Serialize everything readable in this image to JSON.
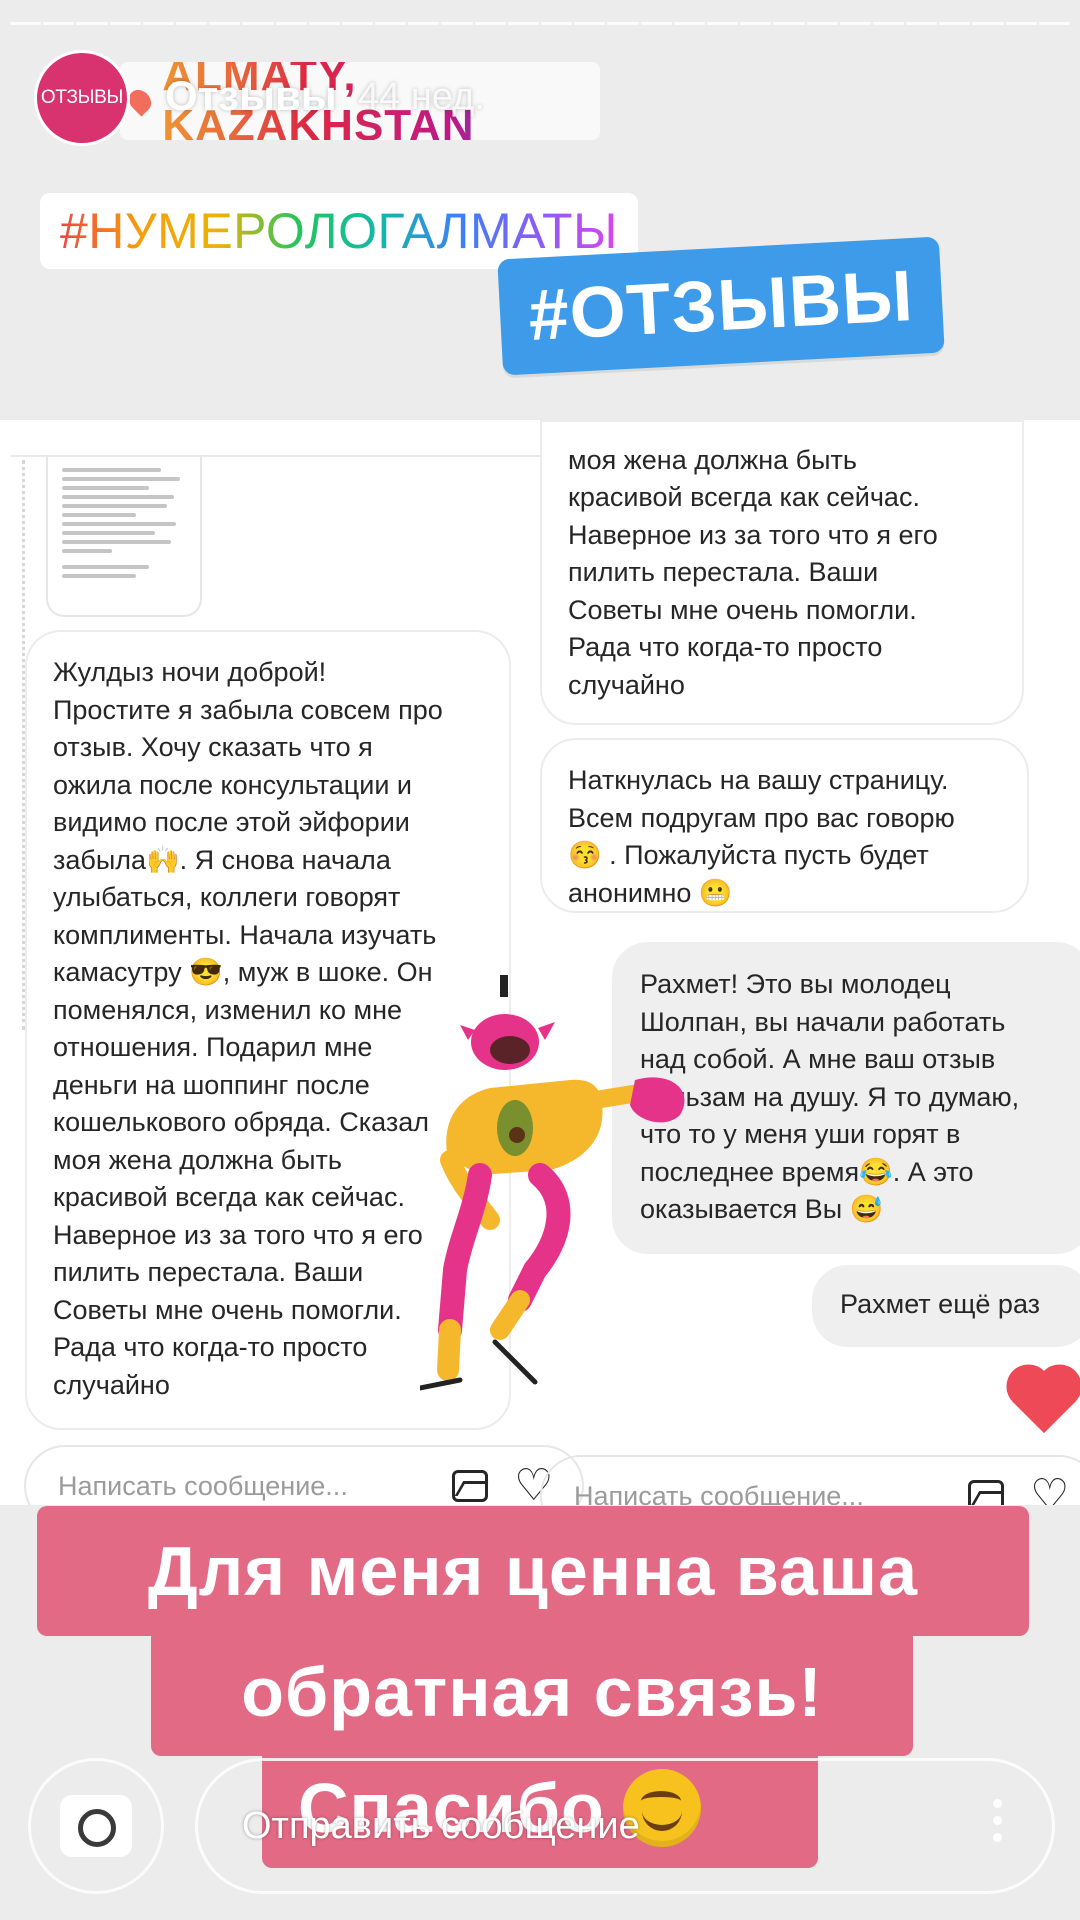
{
  "story": {
    "avatar_label": "ОТЗЫВЫ",
    "username": "Отзывы",
    "time_ago": "44 нед.",
    "location_sticker": "ALMATY, KAZAKHSTAN",
    "progress_segments": 32
  },
  "stickers": {
    "hashtag_rainbow": "#НУМЕРОЛОГАЛМАТЫ",
    "hashtag_blue": "#ОТЗЫВЫ"
  },
  "chat_left": {
    "message": "Жулдыз ночи доброй!\nПростите я забыла совсем про\nотзыв. Хочу сказать что я\nожила после консультации и\nвидимо после этой эйфории\nзабыла🙌. Я снова начала\nулыбаться, коллеги говорят\nкомплименты. Начала изучать\nкамасутру 😎, муж в шоке. Он\nпоменялся, изменил ко мне\nотношения. Подарил мне\nденьги на шоппинг после\nкошелькового обряда. Сказал\nмоя жена должна быть\nкрасивой всегда как сейчас.\nНаверное из за того что я его\nпилить перестала. Ваши\nСоветы мне очень помогли.\nРада что когда-то просто\nслучайно",
    "composer_placeholder": "Написать сообщение..."
  },
  "chat_right": {
    "message_cut": "моя жена должна быть\nкрасивой всегда как сейчас.\nНаверное из за того что я его\nпилить перестала. Ваши\nСоветы мне очень помогли.\nРада что когда-то просто\nслучайно",
    "message_2": "Наткнулась на вашу страницу.\nВсем подругам про вас говорю\n😚 . Пожалуйста пусть будет\nанонимно 😬",
    "reply_1": "Рахмет! Это вы молодец\nШолпан, вы начали работать\nнад собой. А мне ваш отзыв\nбальзам на душу. Я то думаю,\nчто то у меня уши горят в\nпоследнее время😂. А это\nоказывается Вы 😅",
    "reply_2": "Рахмет ещё раз",
    "composer_placeholder": "Написать сообщение..."
  },
  "banner": {
    "line1": "Для меня ценна ваша",
    "line2": "обратная связь!",
    "line3": "Спасибо"
  },
  "bottom_bar": {
    "send_placeholder": "Отправить сообщение"
  },
  "colors": {
    "avatar": "#d8336f",
    "hashtag_blue_bg": "#3d9be9",
    "banner_bg": "#e36a84",
    "heart": "#ed4956"
  }
}
